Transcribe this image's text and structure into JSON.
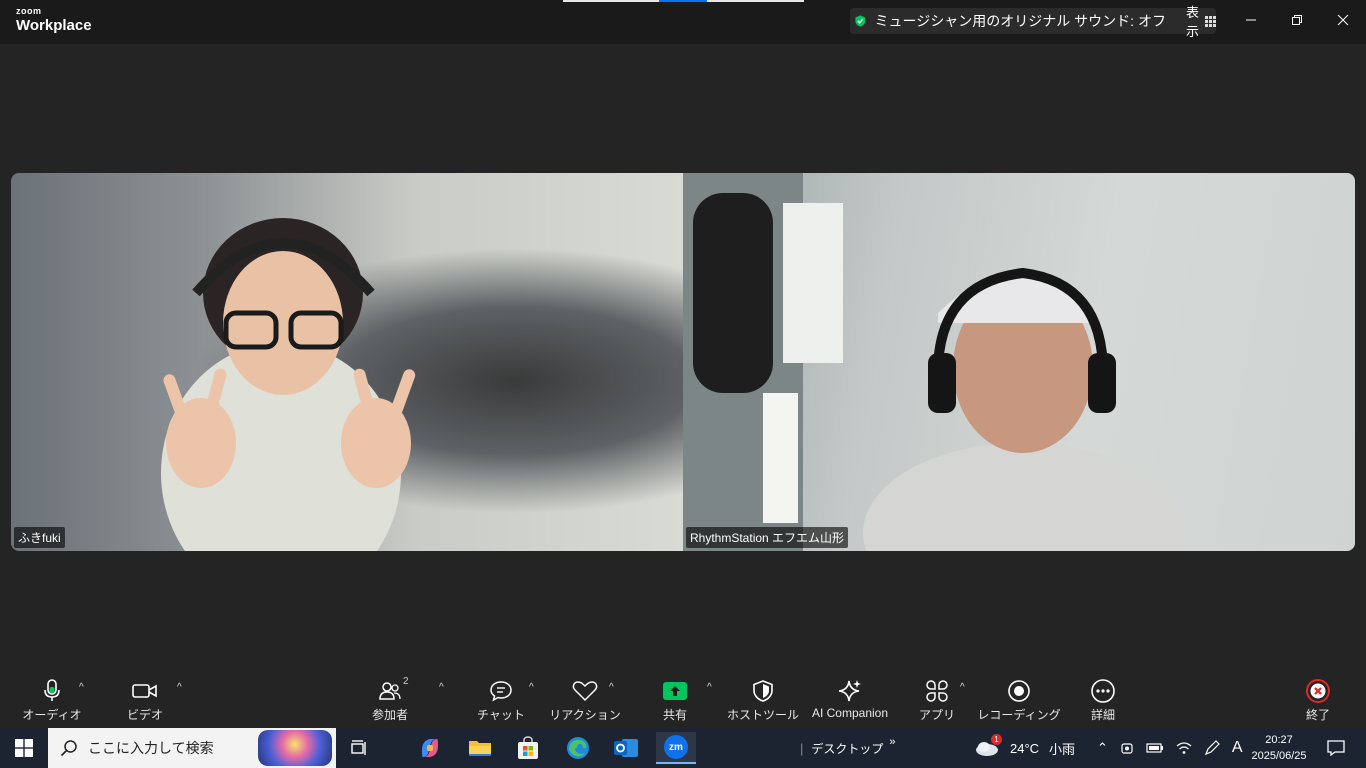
{
  "titlebar": {
    "logo_small": "zoom",
    "logo_big": "Workplace",
    "status_text": "ミュージシャン用のオリジナル サウンド: オフ",
    "view_label": "表示"
  },
  "participants": [
    {
      "name": "ふきfuki"
    },
    {
      "name": "RhythmStation エフエム山形"
    }
  ],
  "toolbar": {
    "audio": "オーディオ",
    "video": "ビデオ",
    "participants": "参加者",
    "participants_count": "2",
    "chat": "チャット",
    "reactions": "リアクション",
    "share": "共有",
    "host_tools": "ホストツール",
    "ai_companion": "AI Companion",
    "apps": "アプリ",
    "recording": "レコーディング",
    "more": "詳細",
    "end": "終了"
  },
  "taskbar": {
    "search_placeholder": "ここに入力して検索",
    "desktop_label": "デスクトップ",
    "weather_badge": "1",
    "temperature": "24°C",
    "weather": "小雨",
    "ime": "A",
    "time": "20:27",
    "date": "2025/06/25",
    "zoom_icon_text": "zm"
  },
  "colors": {
    "accent_green": "#00c65e",
    "share_green": "#00c65e",
    "end_red": "#e02828",
    "zoom_blue": "#0e72ed"
  }
}
